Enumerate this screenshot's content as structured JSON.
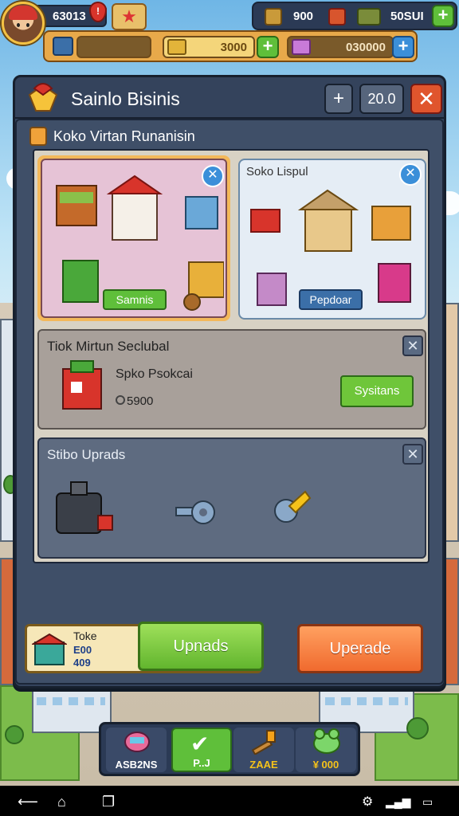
{
  "hud": {
    "level_value": "63013",
    "ruby_mark": "!",
    "resource_1_value": "900",
    "resource_2_value": "50SUI",
    "slot_1_value": "3000",
    "slot_2_value": "030000"
  },
  "panel": {
    "title": "Sainlo Bisinis",
    "plus_label": "+",
    "counter_label": "20.0",
    "close_label": "✕",
    "subtitle": "Koko Virtan Runanisin"
  },
  "cards": [
    {
      "label": "",
      "button_label": "Samnis"
    },
    {
      "label": "Soko Lispul",
      "button_label": "Pepdoar"
    }
  ],
  "section_1": {
    "title": "Tiok Mirtun Seclubal",
    "item_name": "Spko Psokcai",
    "item_price": "5900",
    "button_label": "Sysitans"
  },
  "section_2": {
    "title": "Stibo Uprads"
  },
  "bottom": {
    "cost_label": "Toke",
    "cost_value_1": "E00",
    "cost_value_2": "409",
    "primary_label": "Upnads",
    "secondary_label": "Uperade"
  },
  "nav": [
    {
      "label": "ASB2NS"
    },
    {
      "label": "P..J"
    },
    {
      "label": "ZAAE"
    },
    {
      "label": "¥ 000"
    }
  ],
  "colors": {
    "panel_bg": "#34435c",
    "accent_green": "#62b52e",
    "accent_orange": "#f06a2e",
    "accent_blue": "#3b8fd9"
  }
}
